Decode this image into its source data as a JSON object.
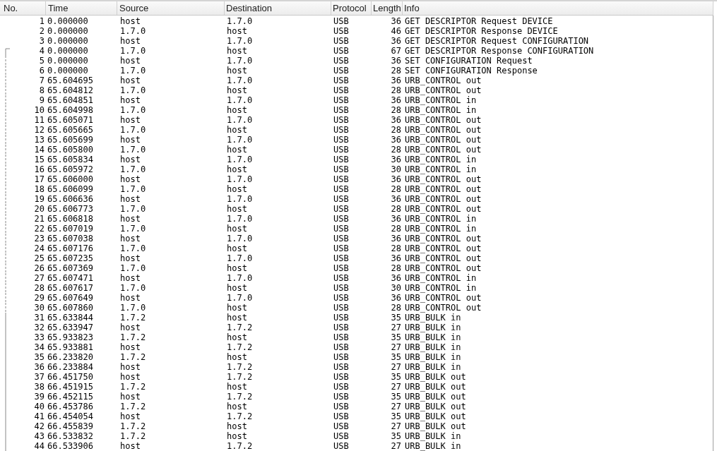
{
  "columns": [
    "No.",
    "Time",
    "Source",
    "Destination",
    "Protocol",
    "Length",
    "Info"
  ],
  "rows": [
    {
      "no": "1",
      "time": "0.000000",
      "source": "host",
      "destination": "1.7.0",
      "protocol": "USB",
      "length": "36",
      "info": "GET DESCRIPTOR Request DEVICE",
      "kind": "plain"
    },
    {
      "no": "2",
      "time": "0.000000",
      "source": "1.7.0",
      "destination": "host",
      "protocol": "USB",
      "length": "46",
      "info": "GET DESCRIPTOR Response DEVICE",
      "kind": "plain"
    },
    {
      "no": "3",
      "time": "0.000000",
      "source": "host",
      "destination": "1.7.0",
      "protocol": "USB",
      "length": "36",
      "info": "GET DESCRIPTOR Request CONFIGURATION",
      "kind": "plain"
    },
    {
      "no": "4",
      "time": "0.000000",
      "source": "1.7.0",
      "destination": "host",
      "protocol": "USB",
      "length": "67",
      "info": "GET DESCRIPTOR Response CONFIGURATION",
      "kind": "bracket"
    },
    {
      "no": "5",
      "time": "0.000000",
      "source": "host",
      "destination": "1.7.0",
      "protocol": "USB",
      "length": "36",
      "info": "SET CONFIGURATION Request",
      "kind": "dashed"
    },
    {
      "no": "6",
      "time": "0.000000",
      "source": "1.7.0",
      "destination": "host",
      "protocol": "USB",
      "length": "28",
      "info": "SET CONFIGURATION Response",
      "kind": "dashed"
    },
    {
      "no": "7",
      "time": "65.604695",
      "source": "host",
      "destination": "1.7.0",
      "protocol": "USB",
      "length": "36",
      "info": "URB_CONTROL out",
      "kind": "dashed"
    },
    {
      "no": "8",
      "time": "65.604812",
      "source": "1.7.0",
      "destination": "host",
      "protocol": "USB",
      "length": "28",
      "info": "URB_CONTROL out",
      "kind": "dashed"
    },
    {
      "no": "9",
      "time": "65.604851",
      "source": "host",
      "destination": "1.7.0",
      "protocol": "USB",
      "length": "36",
      "info": "URB_CONTROL in",
      "kind": "dashed"
    },
    {
      "no": "10",
      "time": "65.604998",
      "source": "1.7.0",
      "destination": "host",
      "protocol": "USB",
      "length": "28",
      "info": "URB_CONTROL in",
      "kind": "dashed"
    },
    {
      "no": "11",
      "time": "65.605071",
      "source": "host",
      "destination": "1.7.0",
      "protocol": "USB",
      "length": "36",
      "info": "URB_CONTROL out",
      "kind": "dashed"
    },
    {
      "no": "12",
      "time": "65.605665",
      "source": "1.7.0",
      "destination": "host",
      "protocol": "USB",
      "length": "28",
      "info": "URB_CONTROL out",
      "kind": "dashed"
    },
    {
      "no": "13",
      "time": "65.605699",
      "source": "host",
      "destination": "1.7.0",
      "protocol": "USB",
      "length": "36",
      "info": "URB_CONTROL out",
      "kind": "dashed"
    },
    {
      "no": "14",
      "time": "65.605800",
      "source": "1.7.0",
      "destination": "host",
      "protocol": "USB",
      "length": "28",
      "info": "URB_CONTROL out",
      "kind": "dashed"
    },
    {
      "no": "15",
      "time": "65.605834",
      "source": "host",
      "destination": "1.7.0",
      "protocol": "USB",
      "length": "36",
      "info": "URB_CONTROL in",
      "kind": "dashed"
    },
    {
      "no": "16",
      "time": "65.605972",
      "source": "1.7.0",
      "destination": "host",
      "protocol": "USB",
      "length": "30",
      "info": "URB_CONTROL in",
      "kind": "dashed"
    },
    {
      "no": "17",
      "time": "65.606000",
      "source": "host",
      "destination": "1.7.0",
      "protocol": "USB",
      "length": "36",
      "info": "URB_CONTROL out",
      "kind": "dashed"
    },
    {
      "no": "18",
      "time": "65.606099",
      "source": "1.7.0",
      "destination": "host",
      "protocol": "USB",
      "length": "28",
      "info": "URB_CONTROL out",
      "kind": "dashed"
    },
    {
      "no": "19",
      "time": "65.606636",
      "source": "host",
      "destination": "1.7.0",
      "protocol": "USB",
      "length": "36",
      "info": "URB_CONTROL out",
      "kind": "dashed"
    },
    {
      "no": "20",
      "time": "65.606773",
      "source": "1.7.0",
      "destination": "host",
      "protocol": "USB",
      "length": "28",
      "info": "URB_CONTROL out",
      "kind": "dashed"
    },
    {
      "no": "21",
      "time": "65.606818",
      "source": "host",
      "destination": "1.7.0",
      "protocol": "USB",
      "length": "36",
      "info": "URB_CONTROL in",
      "kind": "dashed"
    },
    {
      "no": "22",
      "time": "65.607019",
      "source": "1.7.0",
      "destination": "host",
      "protocol": "USB",
      "length": "28",
      "info": "URB_CONTROL in",
      "kind": "dashed"
    },
    {
      "no": "23",
      "time": "65.607038",
      "source": "host",
      "destination": "1.7.0",
      "protocol": "USB",
      "length": "36",
      "info": "URB_CONTROL out",
      "kind": "dashed"
    },
    {
      "no": "24",
      "time": "65.607176",
      "source": "1.7.0",
      "destination": "host",
      "protocol": "USB",
      "length": "28",
      "info": "URB_CONTROL out",
      "kind": "dashed"
    },
    {
      "no": "25",
      "time": "65.607235",
      "source": "host",
      "destination": "1.7.0",
      "protocol": "USB",
      "length": "36",
      "info": "URB_CONTROL out",
      "kind": "dashed"
    },
    {
      "no": "26",
      "time": "65.607369",
      "source": "1.7.0",
      "destination": "host",
      "protocol": "USB",
      "length": "28",
      "info": "URB_CONTROL out",
      "kind": "dashed"
    },
    {
      "no": "27",
      "time": "65.607471",
      "source": "host",
      "destination": "1.7.0",
      "protocol": "USB",
      "length": "36",
      "info": "URB_CONTROL in",
      "kind": "dashed"
    },
    {
      "no": "28",
      "time": "65.607617",
      "source": "1.7.0",
      "destination": "host",
      "protocol": "USB",
      "length": "30",
      "info": "URB_CONTROL in",
      "kind": "dashed"
    },
    {
      "no": "29",
      "time": "65.607649",
      "source": "host",
      "destination": "1.7.0",
      "protocol": "USB",
      "length": "36",
      "info": "URB_CONTROL out",
      "kind": "dashed"
    },
    {
      "no": "30",
      "time": "65.607860",
      "source": "1.7.0",
      "destination": "host",
      "protocol": "USB",
      "length": "28",
      "info": "URB_CONTROL out",
      "kind": "dashed"
    },
    {
      "no": "31",
      "time": "65.633844",
      "source": "1.7.2",
      "destination": "host",
      "protocol": "USB",
      "length": "35",
      "info": "URB_BULK in",
      "kind": "solid"
    },
    {
      "no": "32",
      "time": "65.633947",
      "source": "host",
      "destination": "1.7.2",
      "protocol": "USB",
      "length": "27",
      "info": "URB_BULK in",
      "kind": "solid"
    },
    {
      "no": "33",
      "time": "65.933823",
      "source": "1.7.2",
      "destination": "host",
      "protocol": "USB",
      "length": "35",
      "info": "URB_BULK in",
      "kind": "solid"
    },
    {
      "no": "34",
      "time": "65.933881",
      "source": "host",
      "destination": "1.7.2",
      "protocol": "USB",
      "length": "27",
      "info": "URB_BULK in",
      "kind": "solid"
    },
    {
      "no": "35",
      "time": "66.233820",
      "source": "1.7.2",
      "destination": "host",
      "protocol": "USB",
      "length": "35",
      "info": "URB_BULK in",
      "kind": "solid"
    },
    {
      "no": "36",
      "time": "66.233884",
      "source": "host",
      "destination": "1.7.2",
      "protocol": "USB",
      "length": "27",
      "info": "URB_BULK in",
      "kind": "solid"
    },
    {
      "no": "37",
      "time": "66.451750",
      "source": "host",
      "destination": "1.7.2",
      "protocol": "USB",
      "length": "35",
      "info": "URB_BULK out",
      "kind": "solid"
    },
    {
      "no": "38",
      "time": "66.451915",
      "source": "1.7.2",
      "destination": "host",
      "protocol": "USB",
      "length": "27",
      "info": "URB_BULK out",
      "kind": "solid"
    },
    {
      "no": "39",
      "time": "66.452115",
      "source": "host",
      "destination": "1.7.2",
      "protocol": "USB",
      "length": "35",
      "info": "URB_BULK out",
      "kind": "solid"
    },
    {
      "no": "40",
      "time": "66.453786",
      "source": "1.7.2",
      "destination": "host",
      "protocol": "USB",
      "length": "27",
      "info": "URB_BULK out",
      "kind": "solid"
    },
    {
      "no": "41",
      "time": "66.454054",
      "source": "host",
      "destination": "1.7.2",
      "protocol": "USB",
      "length": "35",
      "info": "URB_BULK out",
      "kind": "solid"
    },
    {
      "no": "42",
      "time": "66.455839",
      "source": "1.7.2",
      "destination": "host",
      "protocol": "USB",
      "length": "27",
      "info": "URB_BULK out",
      "kind": "solid"
    },
    {
      "no": "43",
      "time": "66.533832",
      "source": "1.7.2",
      "destination": "host",
      "protocol": "USB",
      "length": "35",
      "info": "URB_BULK in",
      "kind": "solid"
    },
    {
      "no": "44",
      "time": "66.533906",
      "source": "host",
      "destination": "1.7.2",
      "protocol": "USB",
      "length": "27",
      "info": "URB_BULK in",
      "kind": "solid"
    }
  ]
}
